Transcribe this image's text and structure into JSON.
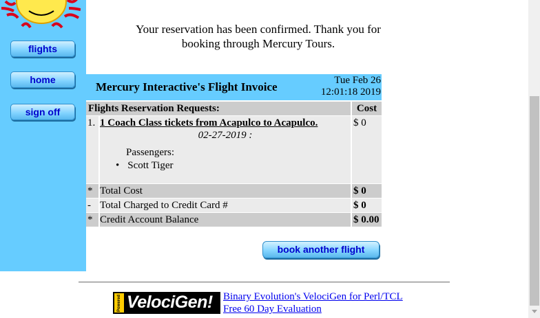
{
  "sidebar": {
    "buttons": [
      "flights",
      "home",
      "sign off"
    ]
  },
  "confirmation": {
    "line1": "Your reservation has been confirmed. Thank you for",
    "line2": "booking through Mercury Tours."
  },
  "invoice": {
    "title": "Mercury Interactive's Flight Invoice",
    "date_line1": "Tue Feb 26",
    "date_line2": "12:01:18 2019",
    "col_requests": "Flights Reservation Requests:",
    "col_cost": "Cost",
    "item": {
      "number": "1.",
      "link": "1 Coach Class tickets from Acapulco to Acapulco.",
      "date": "02-27-2019 :",
      "passengers_label": "Passengers:",
      "passenger": "Scott Tiger",
      "cost": "$ 0"
    },
    "totals": [
      {
        "mark": "*",
        "label": "Total Cost",
        "value": "$ 0"
      },
      {
        "mark": "-",
        "label": "Total Charged to Credit Card #",
        "value": "$ 0"
      },
      {
        "mark": "*",
        "label": "Credit Account Balance",
        "value": "$ 0.00"
      }
    ]
  },
  "book_button": "book another flight",
  "footer": {
    "logo_powered": "Powered By",
    "logo_text": "VelociGen!",
    "link1": "Binary Evolution's VelociGen for Perl/TCL",
    "link2": "Free 60 Day Evaluation"
  },
  "colors": {
    "sidebar": "#66ccff",
    "header": "#66ccff",
    "table_dark": "#cccccc",
    "table_light": "#ebebeb",
    "button_text": "#0000cc"
  }
}
